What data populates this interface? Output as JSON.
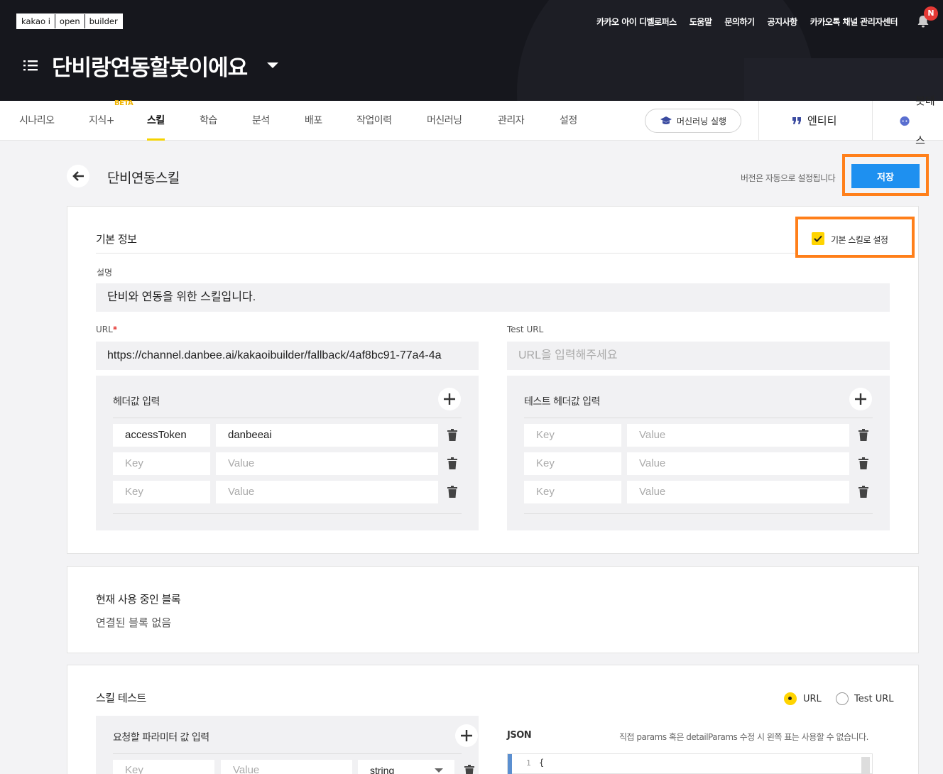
{
  "header": {
    "logo_parts": [
      "kakao i",
      "open",
      "builder"
    ],
    "top_links": [
      "카카오 아이 디벨로퍼스",
      "도움말",
      "문의하기",
      "공지사항",
      "카카오톡 채널 관리자센터"
    ],
    "notification_badge": "N",
    "bot_name": "단비랑연동할봇이에요"
  },
  "nav": {
    "tabs": [
      "시나리오",
      "지식+",
      "스킬",
      "학습",
      "분석",
      "배포",
      "작업이력",
      "머신러닝",
      "관리자",
      "설정"
    ],
    "beta_badge": "BETA",
    "active_tab": "스킬",
    "ml_button": "머신러닝 실행",
    "entity_label": "엔티티",
    "bottest_label": "봇테스"
  },
  "page": {
    "title": "단비연동스킬",
    "version_note": "버전은 자동으로 설정됩니다",
    "save_label": "저장"
  },
  "basic_info": {
    "section_title": "기본 정보",
    "default_skill_label": "기본 스킬로 설정",
    "default_skill_checked": true,
    "description_label": "설명",
    "description_value": "단비와 연동을 위한 스킬입니다.",
    "url_label": "URL",
    "required_mark": "*",
    "url_value": "https://channel.danbee.ai/kakaoibuilder/fallback/4af8bc91-77a4-4a",
    "test_url_label": "Test URL",
    "test_url_placeholder": "URL을 입력해주세요"
  },
  "headers": {
    "title": "헤더값 입력",
    "rows": [
      {
        "key": "accessToken",
        "value": "danbeeai",
        "key_ph": false,
        "value_ph": false
      },
      {
        "key": "Key",
        "value": "Value",
        "key_ph": true,
        "value_ph": true
      },
      {
        "key": "Key",
        "value": "Value",
        "key_ph": true,
        "value_ph": true
      }
    ]
  },
  "test_headers": {
    "title": "테스트 헤더값 입력",
    "rows": [
      {
        "key": "Key",
        "value": "Value"
      },
      {
        "key": "Key",
        "value": "Value"
      },
      {
        "key": "Key",
        "value": "Value"
      }
    ]
  },
  "blocks": {
    "section_title": "현재 사용 중인 블록",
    "empty_text": "연결된 블록 없음"
  },
  "skill_test": {
    "section_title": "스킬 테스트",
    "radio_url": "URL",
    "radio_test_url": "Test URL",
    "selected": "URL",
    "params_title": "요청할 파라미터 값 입력",
    "param_key_ph": "Key",
    "param_value_ph": "Value",
    "param_type": "string",
    "json_title": "JSON",
    "json_note": "직접 params 혹은 detailParams 수정 시 왼쪽 표는 사용할 수 없습니다.",
    "json_line1": "1",
    "json_code1": "{"
  },
  "colors": {
    "accent_yellow": "#ffd400",
    "save_blue": "#1e90f0",
    "highlight_orange": "#ff7f1a",
    "header_bg": "#16171d"
  }
}
